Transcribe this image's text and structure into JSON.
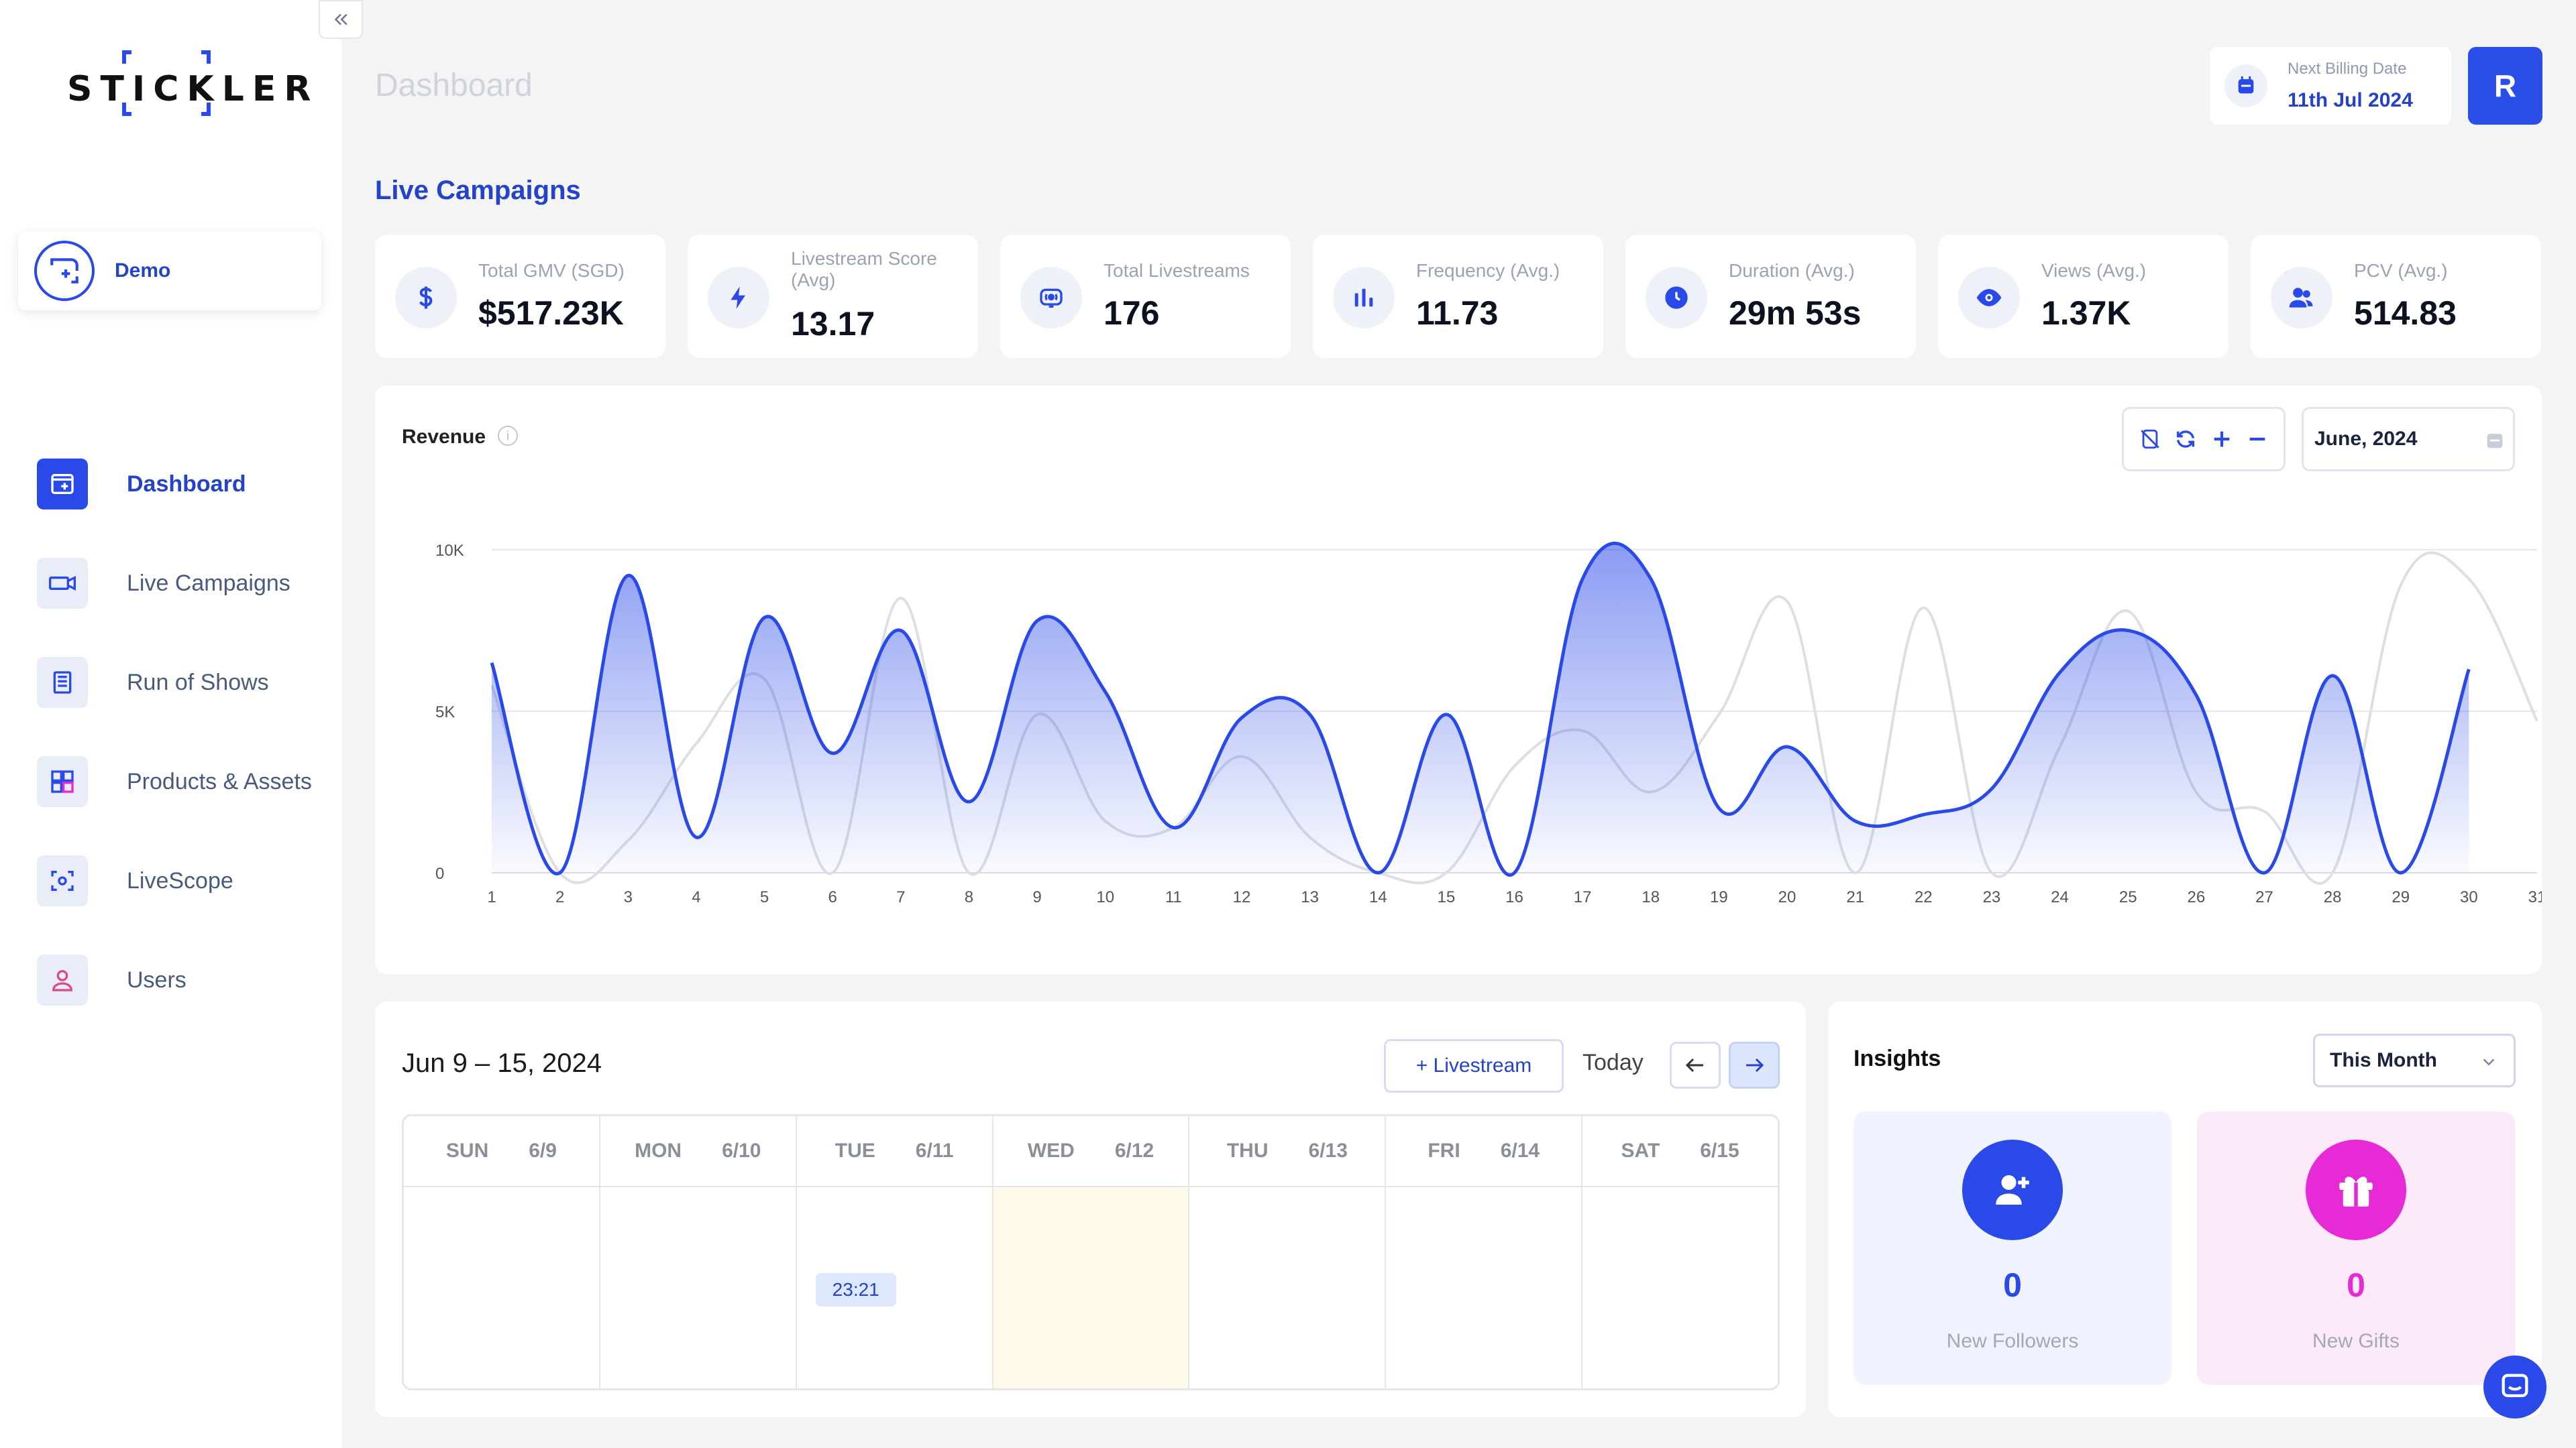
{
  "brand": {
    "logo_text": "STICKLER"
  },
  "workspace": {
    "name": "Demo"
  },
  "sidebar": {
    "items": [
      {
        "label": "Dashboard",
        "icon": "dashboard-icon",
        "active": true
      },
      {
        "label": "Live Campaigns",
        "icon": "video-camera-icon",
        "active": false
      },
      {
        "label": "Run of Shows",
        "icon": "document-list-icon",
        "active": false
      },
      {
        "label": "Products & Assets",
        "icon": "products-grid-icon",
        "active": false
      },
      {
        "label": "LiveScope",
        "icon": "scope-icon",
        "active": false
      },
      {
        "label": "Users",
        "icon": "user-icon",
        "active": false
      }
    ]
  },
  "header": {
    "title": "Dashboard",
    "billing_label": "Next Billing Date",
    "billing_date": "11th Jul 2024",
    "avatar_initial": "R"
  },
  "section_title": "Live Campaigns",
  "stats": [
    {
      "label": "Total GMV (SGD)",
      "value": "$517.23K",
      "icon": "dollar-icon"
    },
    {
      "label": "Livestream Score (Avg)",
      "value": "13.17",
      "icon": "lightning-icon"
    },
    {
      "label": "Total Livestreams",
      "value": "176",
      "icon": "broadcast-icon"
    },
    {
      "label": "Frequency (Avg.)",
      "value": "11.73",
      "icon": "bar-chart-icon"
    },
    {
      "label": "Duration (Avg.)",
      "value": "29m 53s",
      "icon": "clock-icon"
    },
    {
      "label": "Views (Avg.)",
      "value": "1.37K",
      "icon": "eye-icon"
    },
    {
      "label": "PCV (Avg.)",
      "value": "514.83",
      "icon": "users-icon"
    }
  ],
  "revenue_card": {
    "title": "Revenue",
    "month": "June, 2024",
    "tools": [
      "reset-zoom-icon",
      "refresh-icon",
      "zoom-in-icon",
      "zoom-out-icon"
    ]
  },
  "chart_data": {
    "type": "area",
    "ylim": [
      0,
      10000
    ],
    "yticks": [
      "0",
      "5K",
      "10K"
    ],
    "x": [
      1,
      2,
      3,
      4,
      5,
      6,
      7,
      8,
      9,
      10,
      11,
      12,
      13,
      14,
      15,
      16,
      17,
      18,
      19,
      20,
      21,
      22,
      23,
      24,
      25,
      26,
      27,
      28,
      29,
      30,
      31
    ],
    "series": [
      {
        "color": "#2949e8",
        "values": [
          6500,
          0,
          9200,
          1100,
          7900,
          3700,
          7500,
          2200,
          7800,
          5600,
          1400,
          4800,
          4900,
          0,
          4900,
          0,
          9100,
          9100,
          2000,
          3900,
          1600,
          1800,
          2600,
          6200,
          7500,
          5500,
          0,
          6100,
          0,
          6300,
          null
        ]
      },
      {
        "color": "#dedfe3",
        "values": [
          5800,
          0,
          1000,
          4000,
          6000,
          0,
          8500,
          0,
          4900,
          1600,
          1400,
          3600,
          1100,
          0,
          0,
          3300,
          4400,
          2500,
          4900,
          8400,
          0,
          8200,
          0,
          3900,
          8100,
          2500,
          1900,
          0,
          8900,
          9100,
          4700
        ]
      }
    ]
  },
  "calendar": {
    "range": "Jun 9 – 15, 2024",
    "add_label": "+ Livestream",
    "today_label": "Today",
    "days": [
      {
        "name": "SUN",
        "date": "6/9",
        "today": false
      },
      {
        "name": "MON",
        "date": "6/10",
        "today": false
      },
      {
        "name": "TUE",
        "date": "6/11",
        "today": false,
        "event": "23:21"
      },
      {
        "name": "WED",
        "date": "6/12",
        "today": true
      },
      {
        "name": "THU",
        "date": "6/13",
        "today": false
      },
      {
        "name": "FRI",
        "date": "6/14",
        "today": false
      },
      {
        "name": "SAT",
        "date": "6/15",
        "today": false
      }
    ]
  },
  "insights": {
    "title": "Insights",
    "period": "This Month",
    "cards": [
      {
        "label": "New Followers",
        "value": "0",
        "icon": "add-user-icon"
      },
      {
        "label": "New Gifts",
        "value": "0",
        "icon": "gift-icon"
      }
    ]
  }
}
